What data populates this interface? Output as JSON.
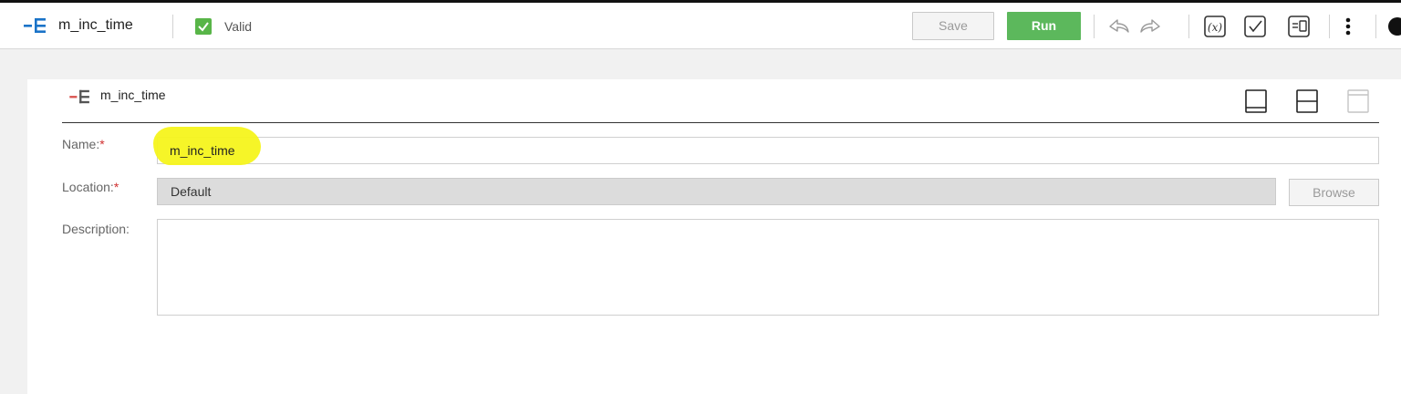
{
  "header": {
    "title": "m_inc_time",
    "status": "Valid",
    "save_label": "Save",
    "run_label": "Run",
    "icons": [
      "mapping-icon",
      "undo-icon",
      "redo-icon",
      "function-icon",
      "validate-icon",
      "parameter-icon",
      "more-vert-icon",
      "close-icon"
    ]
  },
  "card": {
    "title": "m_inc_time",
    "layout_icons": [
      "layout-bottom-icon",
      "layout-split-icon",
      "layout-top-icon"
    ]
  },
  "form": {
    "name_label": "Name:",
    "name_value": "m_inc_time",
    "location_label": "Location:",
    "location_value": "Default",
    "browse_label": "Browse",
    "description_label": "Description:",
    "description_value": "",
    "required_mark": "*"
  },
  "colors": {
    "accent_blue": "#1a73c8",
    "accent_green": "#58b548",
    "run_green": "#5cb85c",
    "highlight_yellow": "#f6f41c",
    "required_red": "#d03030"
  }
}
